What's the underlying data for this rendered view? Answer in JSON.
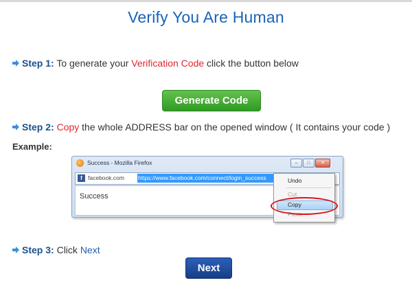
{
  "page": {
    "title": "Verify You Are Human",
    "colors": {
      "title": "#1a63b7",
      "highlight_red": "#e0262b",
      "generate_green": "#2f9b22",
      "next_blue": "#1a4b9c"
    }
  },
  "step1": {
    "icon": "arrow-right-icon",
    "label": "Step 1:",
    "text_before": "To generate your",
    "highlight": "Verification Code",
    "text_after": "click the button below"
  },
  "generate_button": {
    "label": "Generate Code"
  },
  "step2": {
    "icon": "arrow-right-icon",
    "label": "Step 2:",
    "highlight": "Copy",
    "text_after": "the whole ADDRESS bar on the opened window ( It contains your code )"
  },
  "example": {
    "label": "Example:",
    "window_title": "Success - Mozilla Firefox",
    "domain": "facebook.com",
    "url": "https://www.facebook.com/connect/login_success",
    "content": "Success",
    "menu": {
      "undo": "Undo",
      "cut": "Cut",
      "copy": "Copy",
      "paste": "Paste"
    }
  },
  "step3": {
    "icon": "arrow-right-icon",
    "label": "Step 3:",
    "text_before": "Click",
    "highlight": "Next"
  },
  "next_button": {
    "label": "Next"
  }
}
